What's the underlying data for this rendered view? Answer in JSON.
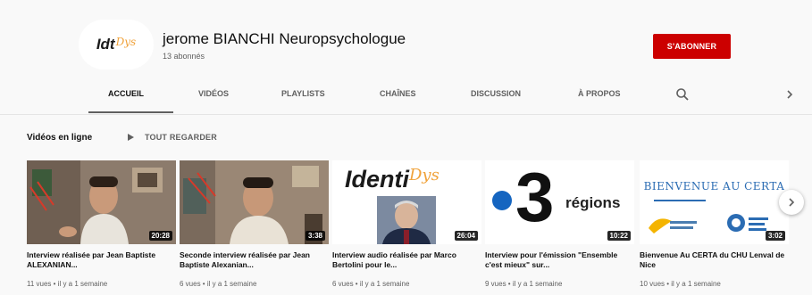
{
  "channel": {
    "logo_main": "Idt",
    "logo_accent": "Dys",
    "name": "jerome BIANCHI Neuropsychologue",
    "subscribers": "13 abonnés",
    "subscribe_label": "S'ABONNER"
  },
  "tabs": [
    {
      "label": "ACCUEIL",
      "active": true
    },
    {
      "label": "VIDÉOS",
      "active": false
    },
    {
      "label": "PLAYLISTS",
      "active": false
    },
    {
      "label": "CHAÎNES",
      "active": false
    },
    {
      "label": "DISCUSSION",
      "active": false
    },
    {
      "label": "À PROPOS",
      "active": false
    }
  ],
  "icons": {
    "search": "search-icon",
    "tabs_next": "chevron-right-icon",
    "shelf_next": "chevron-right-icon",
    "play_all": "play-icon"
  },
  "section": {
    "title": "Vidéos en ligne",
    "play_all": "TOUT REGARDER"
  },
  "videos": [
    {
      "title": "Interview réalisée par Jean Baptiste ALEXANIAN...",
      "duration": "20:28",
      "meta": "11 vues • il y a 1 semaine"
    },
    {
      "title": "Seconde interview réalisée par Jean Baptiste Alexanian...",
      "duration": "3:38",
      "meta": "6 vues • il y a 1 semaine"
    },
    {
      "title": "Interview audio réalisée par Marco Bertolini pour le...",
      "duration": "26:04",
      "meta": "6 vues • il y a 1 semaine",
      "thumb_text_main": "Identi",
      "thumb_text_accent": "Dys"
    },
    {
      "title": "Interview pour l'émission \"Ensemble c'est mieux\" sur...",
      "duration": "10:22",
      "meta": "9 vues • il y a 1 semaine",
      "thumb_number": "3",
      "thumb_text": "régions"
    },
    {
      "title": "Bienvenue Au CERTA du CHU Lenval de Nice",
      "duration": "3:02",
      "meta": "10 vues • il y a 1 semaine",
      "thumb_text": "BIENVENUE AU CERTA"
    }
  ],
  "colors": {
    "subscribe": "#cc0000",
    "accent_orange": "#f0a23a",
    "france3_blue": "#1565c0"
  }
}
